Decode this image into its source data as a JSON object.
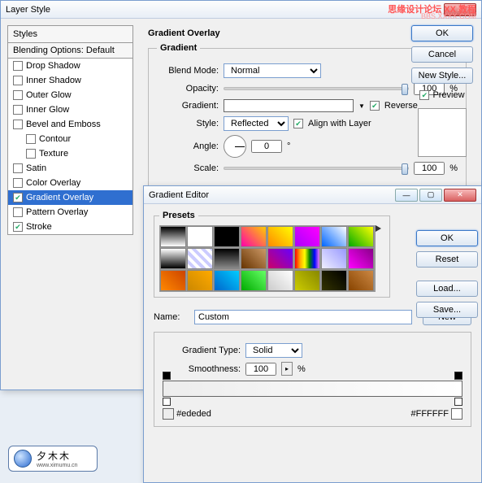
{
  "watermark": {
    "text": "夕木木",
    "url": "www.ximumu.cn"
  },
  "topstamp": {
    "line1": "思缘设计论坛 XX 教程",
    "line2": "BBS.XXXX.COM"
  },
  "layerStyle": {
    "title": "Layer Style",
    "stylesHeader": "Styles",
    "blendingOptions": "Blending Options: Default",
    "items": [
      {
        "label": "Drop Shadow",
        "checked": false
      },
      {
        "label": "Inner Shadow",
        "checked": false
      },
      {
        "label": "Outer Glow",
        "checked": false
      },
      {
        "label": "Inner Glow",
        "checked": false
      },
      {
        "label": "Bevel and Emboss",
        "checked": false
      },
      {
        "label": "Contour",
        "checked": false,
        "indent": true
      },
      {
        "label": "Texture",
        "checked": false,
        "indent": true
      },
      {
        "label": "Satin",
        "checked": false
      },
      {
        "label": "Color Overlay",
        "checked": false
      },
      {
        "label": "Gradient Overlay",
        "checked": true,
        "selected": true
      },
      {
        "label": "Pattern Overlay",
        "checked": false
      },
      {
        "label": "Stroke",
        "checked": true
      }
    ],
    "section": {
      "title": "Gradient Overlay",
      "group": "Gradient",
      "blendModeLabel": "Blend Mode:",
      "blendMode": "Normal",
      "opacityLabel": "Opacity:",
      "opacity": "100",
      "pct": "%",
      "gradientLabel": "Gradient:",
      "reverseLabel": "Reverse",
      "reverse": true,
      "styleLabel": "Style:",
      "style": "Reflected",
      "alignLabel": "Align with Layer",
      "align": true,
      "angleLabel": "Angle:",
      "angle": "0",
      "deg": "°",
      "scaleLabel": "Scale:",
      "scale": "100"
    },
    "buttons": {
      "ok": "OK",
      "cancel": "Cancel",
      "newStyle": "New Style...",
      "previewLabel": "Preview",
      "preview": true
    }
  },
  "gradientEditor": {
    "title": "Gradient Editor",
    "presetsLabel": "Presets",
    "nameLabel": "Name:",
    "name": "Custom",
    "typeLabel": "Gradient Type:",
    "type": "Solid",
    "smoothLabel": "Smoothness:",
    "smoothness": "100",
    "pct": "%",
    "stops": {
      "left": "#ededed",
      "right": "#FFFFFF"
    },
    "buttons": {
      "ok": "OK",
      "reset": "Reset",
      "load": "Load...",
      "save": "Save...",
      "new": "New"
    },
    "swatches": [
      "linear-gradient(#000,#fff)",
      "linear-gradient(#fff,#fff)",
      "linear-gradient(#000,#000)",
      "linear-gradient(45deg,#f0a,#fc0)",
      "linear-gradient(45deg,#f80,#ff0)",
      "linear-gradient(45deg,#a0f,#f0f)",
      "linear-gradient(45deg,#06f,#fff)",
      "linear-gradient(45deg,#0a0,#ff0)",
      "linear-gradient(#fff,#000)",
      "repeating-linear-gradient(45deg,#fff 0 4px,#ccf 4px 8px)",
      "linear-gradient(#000,#888)",
      "linear-gradient(45deg,#630,#c96)",
      "linear-gradient(45deg,#c06,#60f)",
      "linear-gradient(90deg,red,orange,yellow,green,blue,violet)",
      "linear-gradient(45deg,#eef,#99f)",
      "linear-gradient(45deg,#f0f,#808)",
      "linear-gradient(45deg,#f80,#c40)",
      "linear-gradient(45deg,#c80,#fa0)",
      "linear-gradient(45deg,#06c,#0cf)",
      "linear-gradient(45deg,#0a0,#6f6)",
      "linear-gradient(45deg,#ccc,#fff)",
      "linear-gradient(45deg,#cc0,#880)",
      "linear-gradient(45deg,#330,#000)",
      "linear-gradient(45deg,#840,#c84)"
    ]
  }
}
